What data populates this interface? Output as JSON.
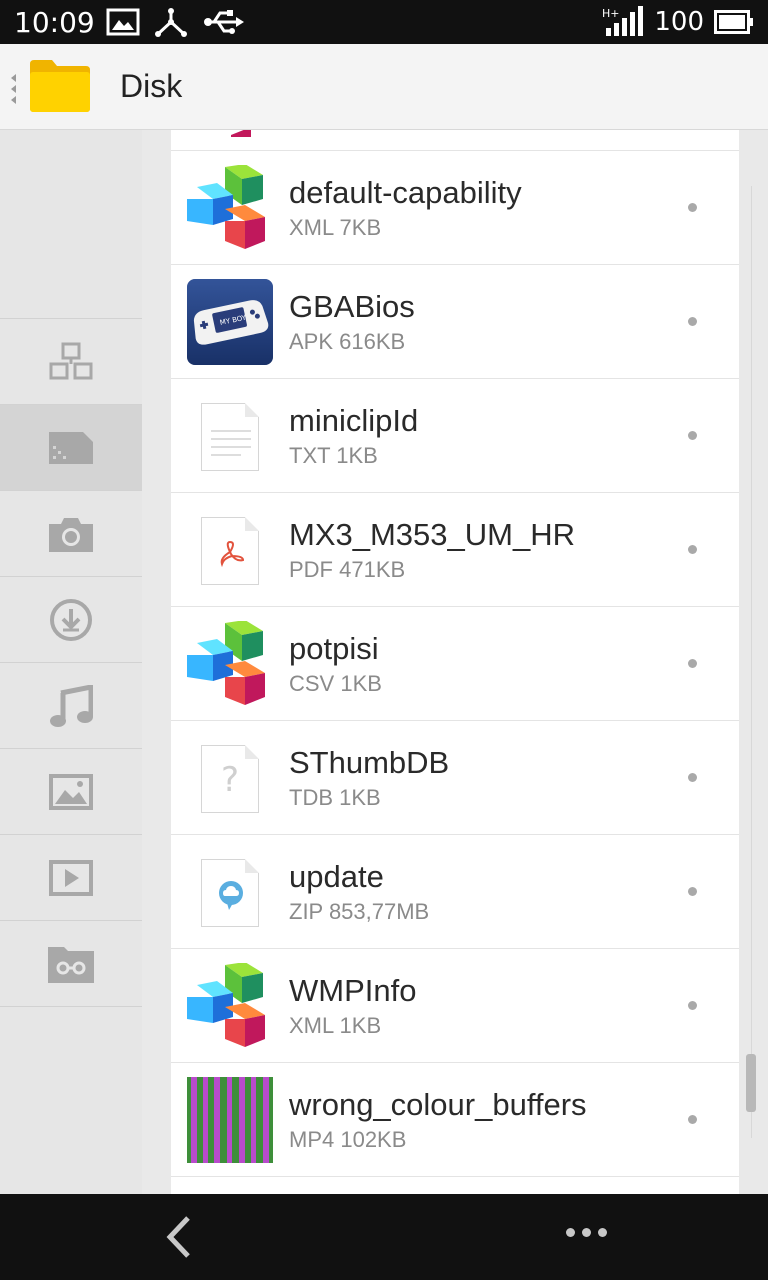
{
  "status_bar": {
    "time": "10:09",
    "network": "H+",
    "battery": "100"
  },
  "header": {
    "title": "Disk"
  },
  "sidebar": {
    "items": [
      {
        "icon": "network-icon"
      },
      {
        "icon": "sd-card-icon",
        "active": true
      },
      {
        "icon": "camera-icon"
      },
      {
        "icon": "download-icon"
      },
      {
        "icon": "music-icon"
      },
      {
        "icon": "image-icon"
      },
      {
        "icon": "video-icon"
      },
      {
        "icon": "private-folder-icon"
      }
    ]
  },
  "files": [
    {
      "name": "default-capability",
      "meta": "XML 7KB",
      "icon": "office-cubes-icon"
    },
    {
      "name": "GBABios",
      "meta": "APK 616KB",
      "icon": "myboy-app-icon"
    },
    {
      "name": "miniclipId",
      "meta": "TXT 1KB",
      "icon": "text-file-icon"
    },
    {
      "name": "MX3_M353_UM_HR",
      "meta": "PDF 471KB",
      "icon": "pdf-file-icon"
    },
    {
      "name": "potpisi",
      "meta": "CSV 1KB",
      "icon": "office-cubes-icon"
    },
    {
      "name": "SThumbDB",
      "meta": "TDB 1KB",
      "icon": "unknown-file-icon"
    },
    {
      "name": "update",
      "meta": "ZIP 853,77MB",
      "icon": "cloud-file-icon"
    },
    {
      "name": "WMPInfo",
      "meta": "XML 1KB",
      "icon": "office-cubes-icon"
    },
    {
      "name": "wrong_colour_buffers",
      "meta": "MP4 102KB",
      "icon": "video-thumbnail"
    }
  ],
  "colors": {
    "folder": "#ffd200",
    "sidebar_icon": "#a8a8a8",
    "accent_pdf": "#e2533d",
    "cloud_blue": "#5aaee0"
  }
}
